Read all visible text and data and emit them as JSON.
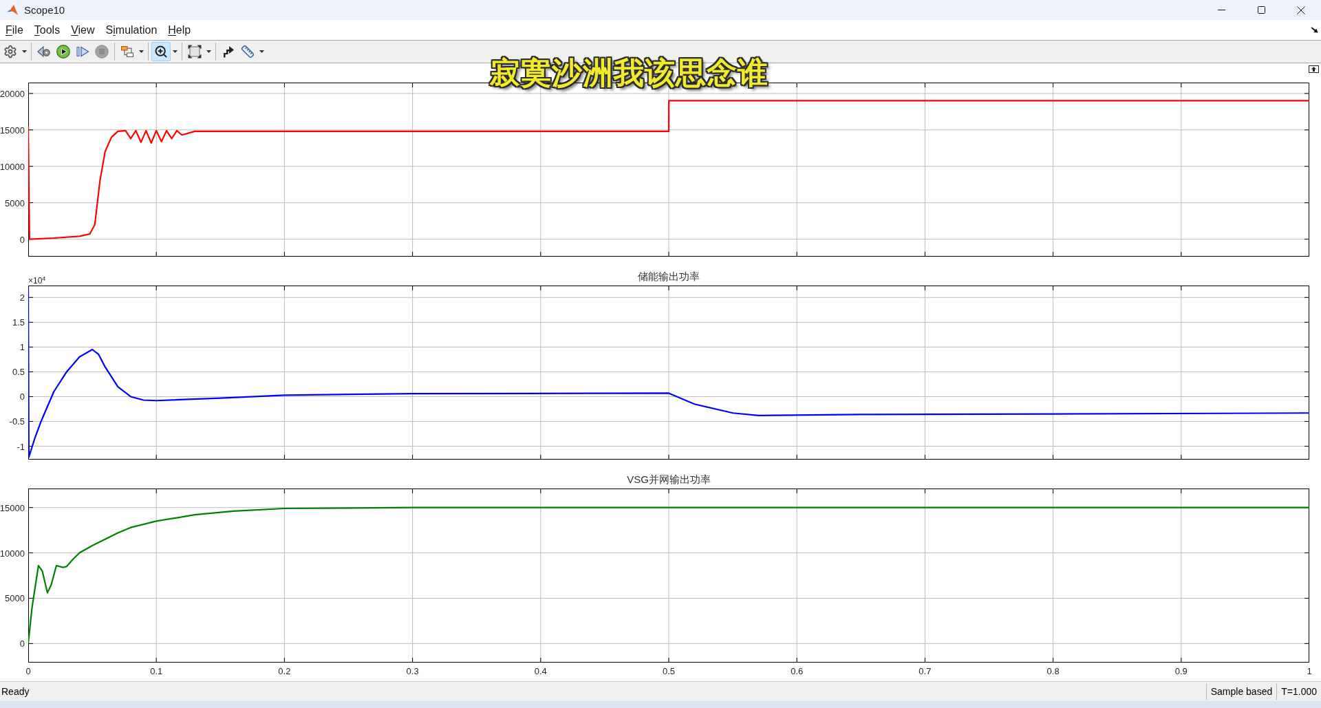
{
  "window": {
    "title": "Scope10"
  },
  "menus": [
    {
      "key": "F",
      "after": "ile"
    },
    {
      "key": "T",
      "after": "ools"
    },
    {
      "key": "V",
      "after": "iew"
    },
    {
      "before": "S",
      "key": "i",
      "after": "mulation"
    },
    {
      "key": "H",
      "after": "elp"
    }
  ],
  "toolbar": [
    {
      "kind": "settings",
      "dropdown": true,
      "selected": false,
      "disabled": false
    },
    {
      "kind": "separator"
    },
    {
      "kind": "step-back",
      "selected": false,
      "disabled": false
    },
    {
      "kind": "run",
      "selected": false,
      "disabled": false
    },
    {
      "kind": "step-forward",
      "selected": false,
      "disabled": false
    },
    {
      "kind": "stop",
      "selected": false,
      "disabled": true
    },
    {
      "kind": "separator"
    },
    {
      "kind": "blocks",
      "dropdown": true,
      "selected": false,
      "disabled": false
    },
    {
      "kind": "separator"
    },
    {
      "kind": "zoom-in",
      "dropdown": true,
      "selected": true,
      "disabled": false
    },
    {
      "kind": "separator"
    },
    {
      "kind": "fit",
      "dropdown": true,
      "selected": false,
      "disabled": false
    },
    {
      "kind": "separator"
    },
    {
      "kind": "stair",
      "selected": false,
      "disabled": false
    },
    {
      "kind": "ruler",
      "dropdown": true,
      "selected": false,
      "disabled": false
    }
  ],
  "lyrics_overlay": {
    "text": "寂寞沙洲我该思念谁"
  },
  "plots": [
    {
      "chart_data": {
        "type": "line",
        "grid": true,
        "x": [
          0,
          0.001,
          0.02,
          0.04,
          0.048,
          0.052,
          0.056,
          0.06,
          0.065,
          0.07,
          0.076,
          0.08,
          0.084,
          0.088,
          0.092,
          0.096,
          0.1,
          0.104,
          0.108,
          0.112,
          0.116,
          0.12,
          0.13,
          0.5,
          0.5001,
          1
        ],
        "series": [
          {
            "color": "#ff0000",
            "values": [
              15600,
              0,
              150,
              400,
              700,
              2000,
              8000,
              12000,
              14000,
              14800,
              14900,
              13800,
              14900,
              13300,
              14900,
              13200,
              14900,
              13400,
              14900,
              13800,
              14900,
              14300,
              14800,
              14800,
              19000,
              19000
            ]
          }
        ],
        "xlim": [
          0,
          1
        ],
        "ylim": [
          -2400,
          21500
        ],
        "yticks": [
          0,
          5000,
          10000,
          15000,
          20000
        ]
      }
    },
    {
      "axis_multiplier": "×10$^{4}$",
      "chart_data": {
        "type": "line",
        "title": "储能输出功率",
        "grid": true,
        "x": [
          0,
          0.0005,
          0.005,
          0.01,
          0.02,
          0.03,
          0.04,
          0.05,
          0.055,
          0.06,
          0.07,
          0.08,
          0.09,
          0.1,
          0.15,
          0.2,
          0.3,
          0.5,
          0.52,
          0.55,
          0.57,
          0.65,
          0.8,
          1
        ],
        "series": [
          {
            "color": "#0000ff",
            "values": [
              2.2,
              -1.22,
              -0.85,
              -0.5,
              0.1,
              0.5,
              0.8,
              0.95,
              0.85,
              0.6,
              0.2,
              0,
              -0.07,
              -0.08,
              -0.03,
              0.03,
              0.06,
              0.07,
              -0.15,
              -0.33,
              -0.38,
              -0.36,
              -0.35,
              -0.33
            ]
          }
        ],
        "xlim": [
          0,
          1
        ],
        "ylim": [
          -1.27,
          2.24
        ],
        "yticks": [
          -1,
          -0.5,
          0,
          0.5,
          1,
          1.5,
          2
        ]
      }
    },
    {
      "chart_data": {
        "type": "line",
        "title": "VSG并网输出功率",
        "grid": true,
        "x": [
          0,
          0.003,
          0.008,
          0.011,
          0.015,
          0.018,
          0.022,
          0.027,
          0.03,
          0.035,
          0.04,
          0.05,
          0.06,
          0.07,
          0.08,
          0.1,
          0.13,
          0.16,
          0.2,
          0.3,
          1
        ],
        "series": [
          {
            "color": "#008000",
            "values": [
              0,
              4000,
              8600,
              8000,
              5600,
              6500,
              8600,
              8400,
              8500,
              9300,
              10000,
              10800,
              11500,
              12200,
              12800,
              13500,
              14200,
              14600,
              14900,
              15000,
              15000
            ]
          }
        ],
        "xlim": [
          0,
          1
        ],
        "ylim": [
          -2100,
          17100
        ],
        "xticks": [
          0,
          0.1,
          0.2,
          0.3,
          0.4,
          0.5,
          0.6,
          0.7,
          0.8,
          0.9,
          1
        ],
        "yticks": [
          0,
          5000,
          10000,
          15000
        ]
      }
    }
  ],
  "status_bar": {
    "message": "Ready",
    "fields": [
      "Sample based",
      "T=1.000"
    ]
  }
}
